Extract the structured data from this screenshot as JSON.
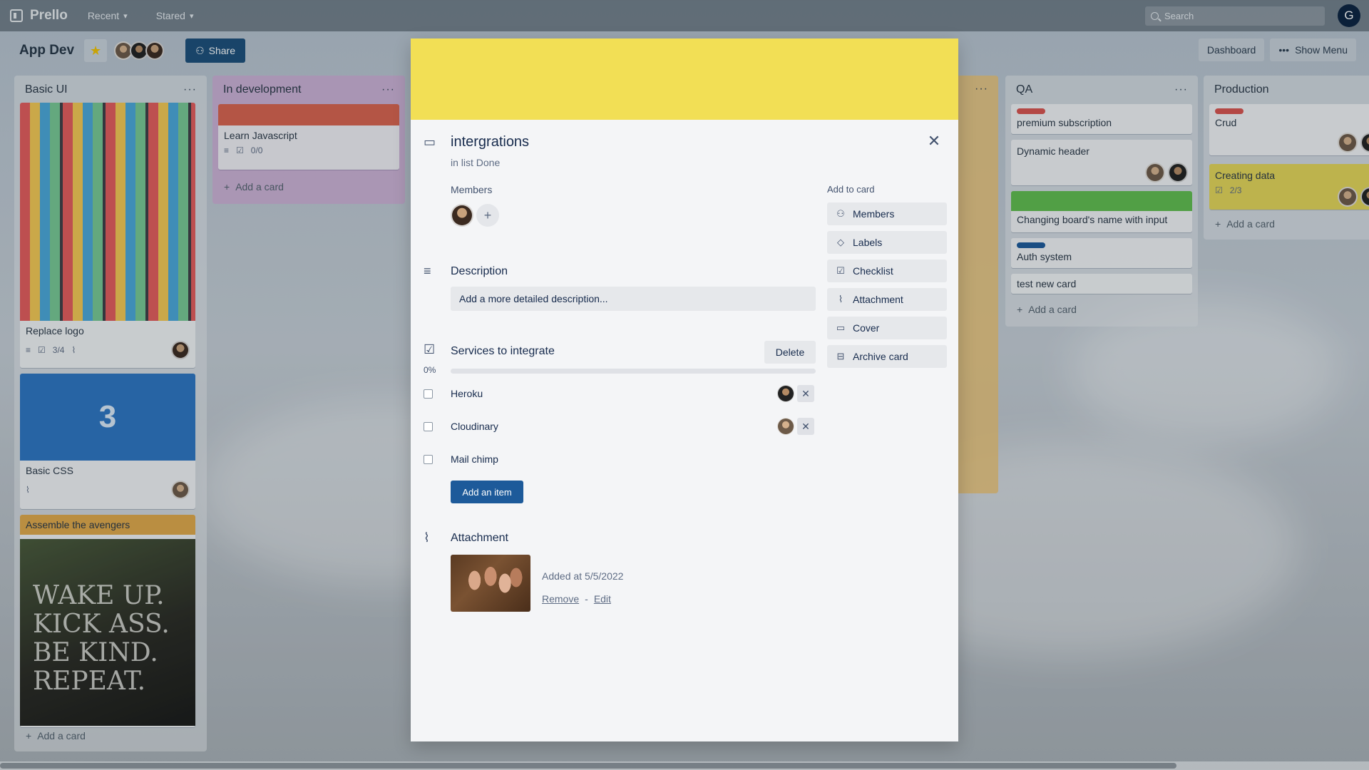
{
  "topbar": {
    "app_name": "Prello",
    "recent_label": "Recent",
    "starred_label": "Stared",
    "search_placeholder": "Search",
    "user_initial": "G"
  },
  "board": {
    "title": "App Dev",
    "share_label": "Share",
    "dashboard_label": "Dashboard",
    "show_menu_label": "Show Menu"
  },
  "lists": {
    "basic_ui": {
      "title": "Basic UI",
      "card1_title": "Replace logo",
      "card1_checklist": "3/4",
      "card2_title": "Basic CSS",
      "card3_title": "Assemble the avengers",
      "card3_quote": "WAKE UP. KICK ASS. BE KIND. REPEAT.",
      "add_card": "Add a card"
    },
    "in_development": {
      "title": "In development",
      "card1_title": "Learn Javascript",
      "card1_checklist": "0/0",
      "add_card": "Add a card"
    },
    "qa": {
      "title": "QA",
      "cards": [
        "premium subscription",
        "Dynamic header",
        "Changing board's name with input",
        "Auth system",
        "test new card"
      ],
      "add_card": "Add a card"
    },
    "production": {
      "title": "Production",
      "card1_title": "Crud",
      "card2_title": "Creating data",
      "card2_checklist": "2/3",
      "add_card": "Add a card"
    }
  },
  "modal": {
    "title": "intergrations",
    "subtitle": "in list Done",
    "members_label": "Members",
    "description_title": "Description",
    "description_placeholder": "Add a more detailed description...",
    "checklist_title": "Services to integrate",
    "delete_label": "Delete",
    "progress_text": "0%",
    "progress_value": 0,
    "checklist_items": [
      {
        "label": "Heroku",
        "checked": false
      },
      {
        "label": "Cloudinary",
        "checked": false
      },
      {
        "label": "Mail chimp",
        "checked": false
      }
    ],
    "add_item_label": "Add an item",
    "attachment_title": "Attachment",
    "attachment_added": "Added at 5/5/2022",
    "remove_label": "Remove",
    "separator": "-",
    "edit_label": "Edit",
    "sidebar_title": "Add to card",
    "sidebar_buttons": [
      "Members",
      "Labels",
      "Checklist",
      "Attachment",
      "Cover",
      "Archive card"
    ]
  },
  "colors": {
    "cover": "#f2df55",
    "accent": "#1d5a9a",
    "label_red": "#d9534f",
    "label_green": "#61bd4f",
    "label_blue": "#1d5a9a",
    "label_orange": "#eeaa44"
  }
}
